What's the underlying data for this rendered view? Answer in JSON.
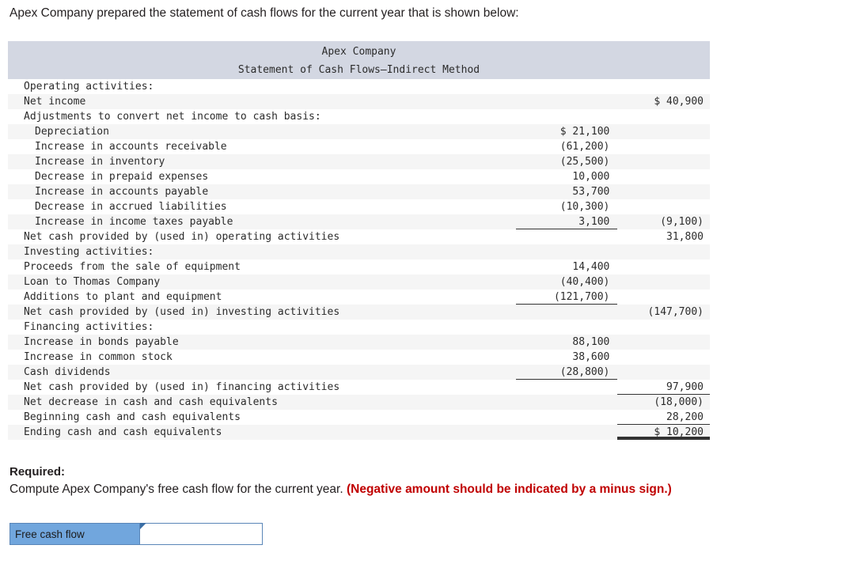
{
  "intro": {
    "text": "Apex Company prepared the statement of cash flows for the current year that is shown below:"
  },
  "statement": {
    "title_line1": "Apex Company",
    "title_line2": "Statement of Cash Flows—Indirect Method",
    "rows": [
      {
        "label": "Operating activities:",
        "indent": 1,
        "num1": "",
        "num2": ""
      },
      {
        "label": "Net income",
        "indent": 1,
        "num1": "",
        "num2": "$ 40,900"
      },
      {
        "label": "Adjustments to convert net income to cash basis:",
        "indent": 1,
        "num1": "",
        "num2": ""
      },
      {
        "label": "Depreciation",
        "indent": 2,
        "num1": "$ 21,100",
        "num2": ""
      },
      {
        "label": "Increase in accounts receivable",
        "indent": 2,
        "num1": "(61,200)",
        "num2": ""
      },
      {
        "label": "Increase in inventory",
        "indent": 2,
        "num1": "(25,500)",
        "num2": ""
      },
      {
        "label": "Decrease in prepaid expenses",
        "indent": 2,
        "num1": "10,000",
        "num2": ""
      },
      {
        "label": "Increase in accounts payable",
        "indent": 2,
        "num1": "53,700",
        "num2": ""
      },
      {
        "label": "Decrease in accrued liabilities",
        "indent": 2,
        "num1": "(10,300)",
        "num2": ""
      },
      {
        "label": "Increase in income taxes payable",
        "indent": 2,
        "num1": "3,100",
        "num2": "(9,100)",
        "rule1": "single"
      },
      {
        "label": "Net cash provided by (used in) operating activities",
        "indent": 1,
        "num1": "",
        "num2": "31,800"
      },
      {
        "label": "Investing activities:",
        "indent": 1,
        "num1": "",
        "num2": ""
      },
      {
        "label": "Proceeds from the sale of equipment",
        "indent": 1,
        "num1": "14,400",
        "num2": ""
      },
      {
        "label": "Loan to Thomas Company",
        "indent": 1,
        "num1": "(40,400)",
        "num2": ""
      },
      {
        "label": "Additions to plant and equipment",
        "indent": 1,
        "num1": "(121,700)",
        "num2": "",
        "rule1": "single"
      },
      {
        "label": "Net cash provided by (used in) investing activities",
        "indent": 1,
        "num1": "",
        "num2": "(147,700)"
      },
      {
        "label": "Financing activities:",
        "indent": 1,
        "num1": "",
        "num2": ""
      },
      {
        "label": "Increase in bonds payable",
        "indent": 1,
        "num1": "88,100",
        "num2": ""
      },
      {
        "label": "Increase in common stock",
        "indent": 1,
        "num1": "38,600",
        "num2": ""
      },
      {
        "label": "Cash dividends",
        "indent": 1,
        "num1": "(28,800)",
        "num2": "",
        "rule1": "single"
      },
      {
        "label": "Net cash provided by (used in) financing activities",
        "indent": 1,
        "num1": "",
        "num2": "97,900",
        "rule2": "single"
      },
      {
        "label": "Net decrease in cash and cash equivalents",
        "indent": 1,
        "num1": "",
        "num2": "(18,000)"
      },
      {
        "label": "Beginning cash and cash equivalents",
        "indent": 1,
        "num1": "",
        "num2": "28,200",
        "rule2": "single"
      },
      {
        "label": "Ending cash and cash equivalents",
        "indent": 1,
        "num1": "",
        "num2": "$ 10,200",
        "rule2": "double",
        "tall": true
      }
    ]
  },
  "required": {
    "heading": "Required:",
    "prompt": "Compute Apex Company's free cash flow for the current year.",
    "warning": "(Negative amount should be indicated by a minus sign.)"
  },
  "answer": {
    "label": "Free cash flow",
    "value": "",
    "placeholder": ""
  },
  "colors": {
    "header_band": "#d3d7e2",
    "zebra_row": "#f5f5f5",
    "answer_label_fill": "#71a6dd",
    "answer_border": "#5a86b8",
    "warning_text": "#c00000",
    "corner_marker": "#3b6ea5"
  }
}
